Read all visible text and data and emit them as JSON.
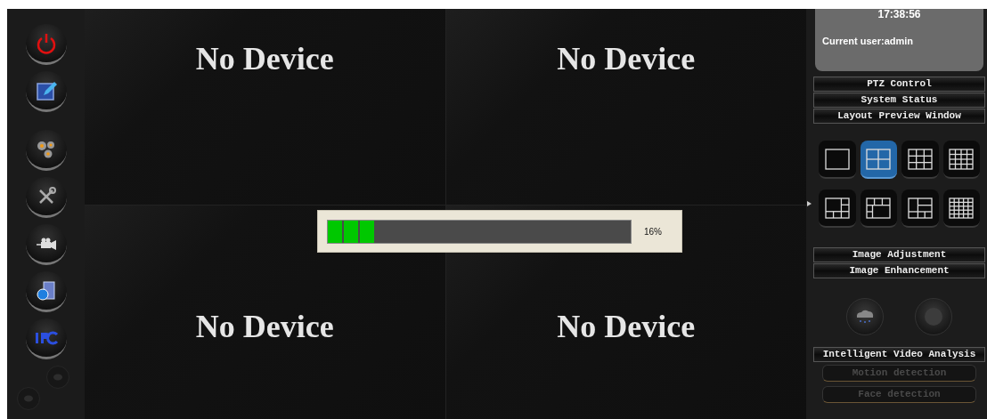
{
  "sidebar": {
    "buttons": [
      {
        "kind": "power",
        "disabled": false
      },
      {
        "kind": "edit",
        "disabled": false
      },
      {
        "kind": "gears",
        "disabled": false
      },
      {
        "kind": "tools",
        "disabled": false
      },
      {
        "kind": "camera",
        "disabled": false
      },
      {
        "kind": "network",
        "disabled": false
      },
      {
        "kind": "ipc",
        "disabled": false
      },
      {
        "kind": "small",
        "disabled": true
      },
      {
        "kind": "small",
        "disabled": true
      }
    ]
  },
  "video_grid": {
    "cells": [
      {
        "label": "No Device"
      },
      {
        "label": "No Device"
      },
      {
        "label": "No Device"
      },
      {
        "label": "No Device"
      }
    ]
  },
  "progress": {
    "level": 0.16,
    "reading": "16%"
  },
  "info": {
    "time": "17:38:56",
    "user": "Current user:admin"
  },
  "menu": [
    {
      "label": "PTZ Control"
    },
    {
      "label": "System Status"
    },
    {
      "label": "Layout Preview Window"
    }
  ],
  "layouts": [
    {
      "kind": "single",
      "selected": false
    },
    {
      "kind": "quad",
      "selected": true
    },
    {
      "kind": "nine",
      "selected": false
    },
    {
      "kind": "sixteen",
      "selected": false
    },
    {
      "kind": "six",
      "selected": false
    },
    {
      "kind": "eight",
      "selected": false
    },
    {
      "kind": "split",
      "selected": false
    },
    {
      "kind": "twentyfive",
      "selected": false
    }
  ],
  "image_menu": [
    {
      "label": "Image Adjustment"
    },
    {
      "label": "Image Enhancement"
    }
  ],
  "image_buttons": [
    {
      "kind": "weather"
    },
    {
      "kind": "dial"
    }
  ],
  "analysis": {
    "title": "Intelligent Video Analysis",
    "items": [
      {
        "label": "Motion detection",
        "disabled": true
      },
      {
        "label": "Face detection",
        "disabled": true
      }
    ]
  }
}
